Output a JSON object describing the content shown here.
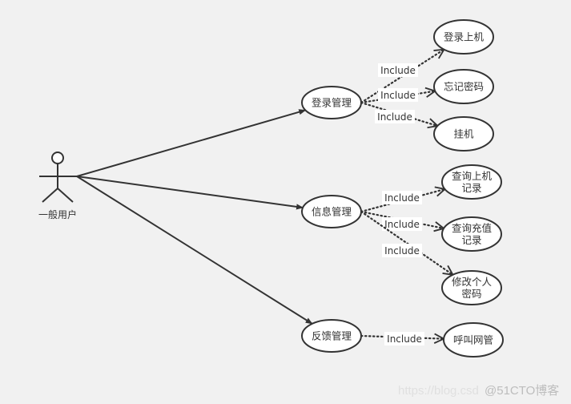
{
  "diagram": {
    "type": "use-case",
    "actor": {
      "label": "一般用户"
    },
    "main_use_cases": [
      {
        "id": "login",
        "label": "登录管理",
        "includes": [
          {
            "label": "登录上机",
            "relation": "Include"
          },
          {
            "label": "忘记密码",
            "relation": "Include"
          },
          {
            "label": "挂机",
            "relation": "Include"
          }
        ]
      },
      {
        "id": "info",
        "label": "信息管理",
        "includes": [
          {
            "label": [
              "查询上机",
              "记录"
            ],
            "relation": "Include"
          },
          {
            "label": [
              "查询充值",
              "记录"
            ],
            "relation": "Include"
          },
          {
            "label": [
              "修改个人",
              "密码"
            ],
            "relation": "Include"
          }
        ]
      },
      {
        "id": "feedback",
        "label": "反馈管理",
        "includes": [
          {
            "label": "呼叫网管",
            "relation": "Include"
          }
        ]
      }
    ],
    "colors": {
      "background": "#f1f1f1",
      "stroke": "#333333",
      "fill": "#ffffff"
    }
  },
  "watermark": {
    "url_part": "https://blog.csd",
    "brand_part": "@51CTO博客"
  }
}
